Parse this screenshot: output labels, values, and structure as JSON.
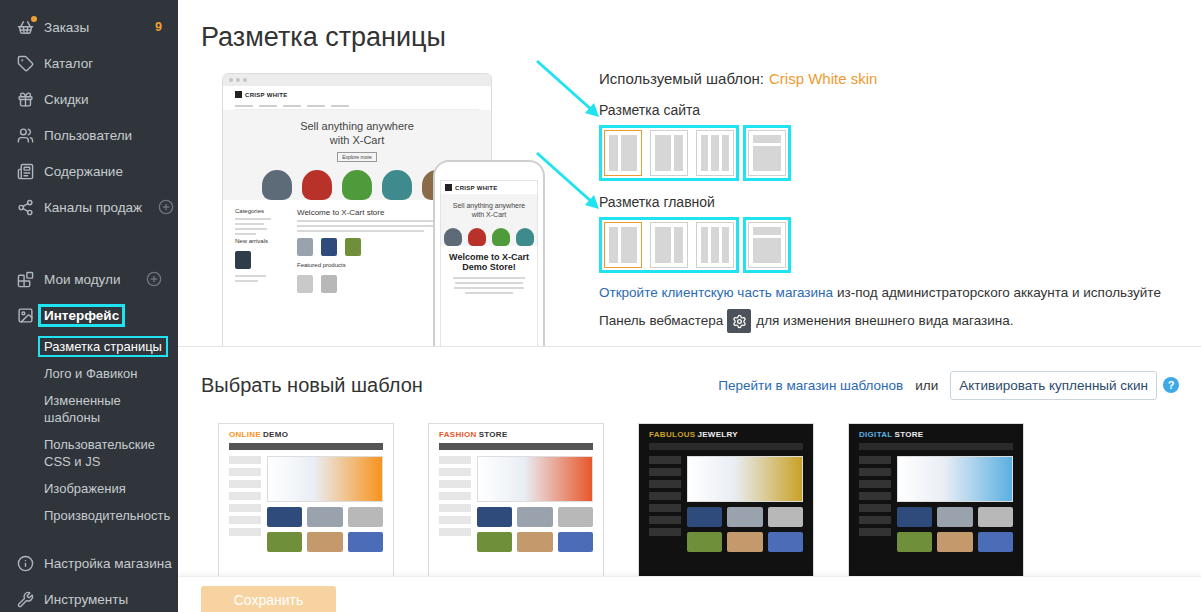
{
  "sidebar": {
    "groups": [
      {
        "items": [
          {
            "label": "Заказы",
            "badge": "9",
            "alert": true,
            "addable": false,
            "selected": false,
            "marked": false,
            "expanded": false,
            "children": []
          },
          {
            "label": "Каталог",
            "badge": "",
            "alert": false,
            "addable": false,
            "selected": false,
            "marked": false,
            "expanded": false,
            "children": []
          },
          {
            "label": "Скидки",
            "badge": "",
            "alert": false,
            "addable": false,
            "selected": false,
            "marked": false,
            "expanded": false,
            "children": []
          },
          {
            "label": "Пользователи",
            "badge": "",
            "alert": false,
            "addable": false,
            "selected": false,
            "marked": false,
            "expanded": false,
            "children": []
          },
          {
            "label": "Содержание",
            "badge": "",
            "alert": false,
            "addable": false,
            "selected": false,
            "marked": false,
            "expanded": false,
            "children": []
          },
          {
            "label": "Каналы продаж",
            "badge": "",
            "alert": false,
            "addable": true,
            "selected": false,
            "marked": false,
            "expanded": false,
            "children": []
          }
        ]
      },
      {
        "items": [
          {
            "label": "Мои модули",
            "badge": "",
            "alert": false,
            "addable": true,
            "selected": false,
            "marked": false,
            "expanded": false,
            "children": []
          },
          {
            "label": "Интерфейс",
            "badge": "",
            "alert": false,
            "addable": false,
            "selected": true,
            "marked": true,
            "expanded": true,
            "children": [
              {
                "label": "Разметка страницы",
                "selected": true,
                "marked": true
              },
              {
                "label": "Лого и Фавикон",
                "selected": false,
                "marked": false
              },
              {
                "label": "Измененные шаблоны",
                "selected": false,
                "marked": false
              },
              {
                "label": "Пользовательские CSS и JS",
                "selected": false,
                "marked": false
              },
              {
                "label": "Изображения",
                "selected": false,
                "marked": false
              },
              {
                "label": "Производительность",
                "selected": false,
                "marked": false
              }
            ]
          }
        ]
      },
      {
        "items": [
          {
            "label": "Настройка магазина",
            "badge": "",
            "alert": false,
            "addable": false,
            "selected": false,
            "marked": false,
            "expanded": false,
            "children": []
          },
          {
            "label": "Инструменты",
            "badge": "",
            "alert": false,
            "addable": false,
            "selected": false,
            "marked": false,
            "expanded": false,
            "children": []
          }
        ]
      }
    ]
  },
  "page": {
    "title": "Разметка страницы"
  },
  "current": {
    "label": "Используемый шаблон:",
    "value": "Crisp White skin"
  },
  "layouts": [
    {
      "title": "Разметка сайта",
      "marked": true,
      "options": [
        {
          "kind": "left",
          "selected": true,
          "box": 0
        },
        {
          "kind": "right",
          "selected": false,
          "box": 0
        },
        {
          "kind": "three",
          "selected": false,
          "box": 0
        },
        {
          "kind": "top",
          "selected": false,
          "box": 1
        }
      ]
    },
    {
      "title": "Разметка главной",
      "marked": true,
      "options": [
        {
          "kind": "left",
          "selected": true,
          "box": 0
        },
        {
          "kind": "right",
          "selected": false,
          "box": 0
        },
        {
          "kind": "three",
          "selected": false,
          "box": 0
        },
        {
          "kind": "top",
          "selected": false,
          "box": 1
        }
      ]
    }
  ],
  "hint": {
    "link": "Откройте клиентскую часть магазина",
    "text": "из-под администраторского аккаунта и используйте Панель вебмастера",
    "after": "для изменения внешнего вида магазина."
  },
  "preview": {
    "desktop": {
      "logo": "CRISP WHITE",
      "hero": "Sell anything anywhere with X-Cart",
      "button": "Explore more",
      "sidebar": "Categories",
      "welcome": "Welcome to X-Cart store",
      "sections": [
        "New arrivals",
        "Featured products"
      ]
    },
    "phone": {
      "logo": "CRISP WHITE",
      "hero": "Sell anything anywhere with X-Cart",
      "welcome": "Welcome to X-Cart Demo Store!"
    }
  },
  "templates_section": {
    "title": "Выбрать новый шаблон",
    "store_link": "Перейти в магазин шаблонов",
    "or": "или",
    "activate": "Активировать купленный скин",
    "help": "?"
  },
  "templates": [
    {
      "logo": "ONLINE",
      "logo_rest": "DEMO",
      "dark": false,
      "color": "#f7941d"
    },
    {
      "logo": "FASHION",
      "logo_rest": "STORE",
      "dark": false,
      "color": "#e8572a"
    },
    {
      "logo": "FABULOUS",
      "logo_rest": "JEWELRY",
      "dark": true,
      "color": "#c9a227"
    },
    {
      "logo": "DIGITAL",
      "logo_rest": "STORE",
      "dark": true,
      "color": "#5bb0e0"
    }
  ],
  "footer": {
    "save": "Сохранить",
    "disabled": true
  }
}
